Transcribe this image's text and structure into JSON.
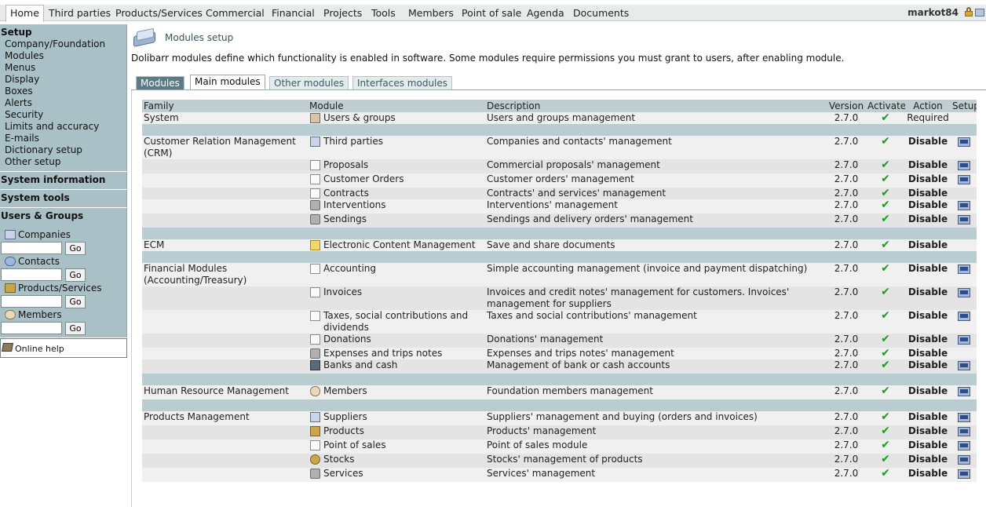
{
  "topmenu": {
    "items": [
      "Home",
      "Third parties",
      "Products/Services",
      "Commercial",
      "Financial",
      "Projects",
      "Tools",
      "Members",
      "Point of sale",
      "Agenda",
      "Documents"
    ],
    "active": "Home",
    "user": "markot84"
  },
  "leftmenu": {
    "setup_title": "Setup",
    "setup_items": [
      "Company/Foundation",
      "Modules",
      "Menus",
      "Display",
      "Boxes",
      "Alerts",
      "Security",
      "Limits and accuracy",
      "E-mails",
      "Dictionary setup",
      "Other setup"
    ],
    "system_information": "System information",
    "system_tools": "System tools",
    "users_groups": "Users & Groups",
    "searches": [
      {
        "label": "Companies",
        "icon": "companies-icon"
      },
      {
        "label": "Contacts",
        "icon": "contacts-icon"
      },
      {
        "label": "Products/Services",
        "icon": "products-icon"
      },
      {
        "label": "Members",
        "icon": "members-icon"
      }
    ],
    "go_label": "Go",
    "online_help": "Online help"
  },
  "page": {
    "title": "Modules setup",
    "description": "Dolibarr modules define which functionality is enabled in software. Some modules require permissions you must grant to users, after enabling module."
  },
  "tabs": {
    "label": "Modules",
    "items": [
      "Main modules",
      "Other modules",
      "Interfaces modules"
    ],
    "active": "Main modules"
  },
  "table": {
    "headers": {
      "family": "Family",
      "module": "Module",
      "description": "Description",
      "version": "Version",
      "activated": "Activated",
      "action": "Action",
      "setup": "Setup"
    },
    "groups": [
      {
        "family": "System",
        "rows": [
          {
            "module": "Users & groups",
            "icon": "users-icon",
            "description": "Users and groups management",
            "version": "2.7.0",
            "action": "Required",
            "setup": false
          }
        ]
      },
      {
        "family": "Customer Relation Management (CRM)",
        "rows": [
          {
            "module": "Third parties",
            "icon": "third-parties-icon",
            "description": "Companies and contacts' management",
            "version": "2.7.0",
            "action": "Disable",
            "setup": true
          },
          {
            "module": "Proposals",
            "icon": "document-icon",
            "description": "Commercial proposals' management",
            "version": "2.7.0",
            "action": "Disable",
            "setup": true
          },
          {
            "module": "Customer Orders",
            "icon": "document-icon",
            "description": "Customer orders' management",
            "version": "2.7.0",
            "action": "Disable",
            "setup": true
          },
          {
            "module": "Contracts",
            "icon": "document-icon",
            "description": "Contracts' and services' management",
            "version": "2.7.0",
            "action": "Disable",
            "setup": false
          },
          {
            "module": "Interventions",
            "icon": "truck-icon",
            "description": "Interventions' management",
            "version": "2.7.0",
            "action": "Disable",
            "setup": true
          },
          {
            "module": "Sendings",
            "icon": "truck-icon",
            "description": "Sendings and delivery orders' management",
            "version": "2.7.0",
            "action": "Disable",
            "setup": true
          }
        ]
      },
      {
        "family": "ECM",
        "rows": [
          {
            "module": "Electronic Content Management",
            "icon": "folder-icon",
            "description": "Save and share documents",
            "version": "2.7.0",
            "action": "Disable",
            "setup": false
          }
        ]
      },
      {
        "family": "Financial Modules (Accounting/Treasury)",
        "rows": [
          {
            "module": "Accounting",
            "icon": "document-icon",
            "description": "Simple accounting management (invoice and payment dispatching)",
            "version": "2.7.0",
            "action": "Disable",
            "setup": true
          },
          {
            "module": "Invoices",
            "icon": "document-icon",
            "description": "Invoices and credit notes' management for customers. Invoices' management for suppliers",
            "version": "2.7.0",
            "action": "Disable",
            "setup": true
          },
          {
            "module": "Taxes, social contributions and dividends",
            "icon": "taxes-icon",
            "description": "Taxes and social contributions' management",
            "version": "2.7.0",
            "action": "Disable",
            "setup": true
          },
          {
            "module": "Donations",
            "icon": "document-icon",
            "description": "Donations' management",
            "version": "2.7.0",
            "action": "Disable",
            "setup": true
          },
          {
            "module": "Expenses and trips notes",
            "icon": "truck-icon",
            "description": "Expenses and trips notes' management",
            "version": "2.7.0",
            "action": "Disable",
            "setup": false
          },
          {
            "module": "Banks and cash",
            "icon": "bank-icon",
            "description": "Management of bank or cash accounts",
            "version": "2.7.0",
            "action": "Disable",
            "setup": true
          }
        ]
      },
      {
        "family": "Human Resource Management",
        "rows": [
          {
            "module": "Members",
            "icon": "member-icon",
            "description": "Foundation members management",
            "version": "2.7.0",
            "action": "Disable",
            "setup": true
          }
        ]
      },
      {
        "family": "Products Management",
        "rows": [
          {
            "module": "Suppliers",
            "icon": "third-parties-icon",
            "description": "Suppliers' management and buying (orders and invoices)",
            "version": "2.7.0",
            "action": "Disable",
            "setup": true
          },
          {
            "module": "Products",
            "icon": "product-icon",
            "description": "Products' management",
            "version": "2.7.0",
            "action": "Disable",
            "setup": true
          },
          {
            "module": "Point of sales",
            "icon": "document-icon",
            "description": "Point of sales module",
            "version": "2.7.0",
            "action": "Disable",
            "setup": true
          },
          {
            "module": "Stocks",
            "icon": "stock-icon",
            "description": "Stocks' management of products",
            "version": "2.7.0",
            "action": "Disable",
            "setup": true
          },
          {
            "module": "Services",
            "icon": "truck-icon",
            "description": "Services' management",
            "version": "2.7.0",
            "action": "Disable",
            "setup": true
          }
        ]
      }
    ]
  },
  "colors": {
    "menu_bg": "#a9c0c7",
    "header_bg": "#c1ced1",
    "separator": "#b9ccd1",
    "check": "#1f9a1f"
  }
}
